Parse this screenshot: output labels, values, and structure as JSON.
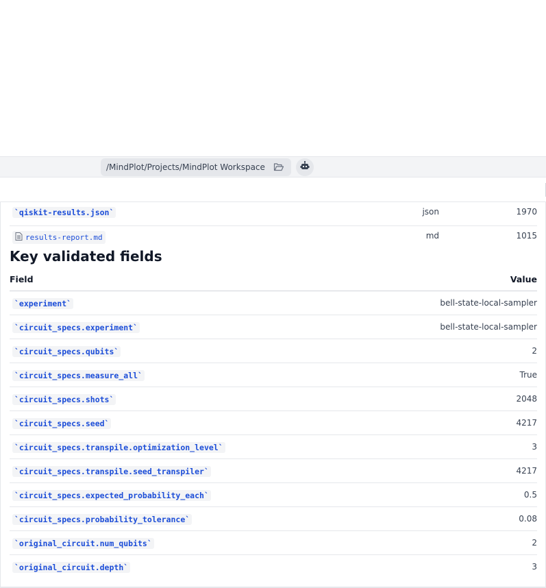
{
  "topbar": {
    "path": "/MindPlot/Projects/MindPlot Workspace"
  },
  "files": [
    {
      "name": "`qiskit-results.json`",
      "type": "json",
      "size": "1970"
    },
    {
      "name": "results-report.md",
      "type": "md",
      "size": "1015"
    }
  ],
  "section": {
    "title": "Key validated fields",
    "col_field": "Field",
    "col_value": "Value"
  },
  "rows": [
    {
      "key": "`experiment`",
      "value": "bell-state-local-sampler"
    },
    {
      "key": "`circuit_specs.experiment`",
      "value": "bell-state-local-sampler"
    },
    {
      "key": "`circuit_specs.qubits`",
      "value": "2"
    },
    {
      "key": "`circuit_specs.measure_all`",
      "value": "True"
    },
    {
      "key": "`circuit_specs.shots`",
      "value": "2048"
    },
    {
      "key": "`circuit_specs.seed`",
      "value": "4217"
    },
    {
      "key": "`circuit_specs.transpile.optimization_level`",
      "value": "3"
    },
    {
      "key": "`circuit_specs.transpile.seed_transpiler`",
      "value": "4217"
    },
    {
      "key": "`circuit_specs.expected_probability_each`",
      "value": "0.5"
    },
    {
      "key": "`circuit_specs.probability_tolerance`",
      "value": "0.08"
    },
    {
      "key": "`original_circuit.num_qubits`",
      "value": "2"
    },
    {
      "key": "`original_circuit.depth`",
      "value": "3"
    }
  ]
}
